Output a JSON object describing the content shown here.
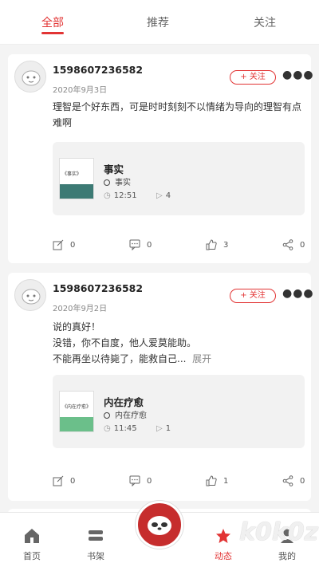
{
  "tabs": [
    {
      "label": "全部"
    },
    {
      "label": "推荐"
    },
    {
      "label": "关注"
    }
  ],
  "posts": [
    {
      "username": "1598607236582",
      "date": "2020年9月3日",
      "follow_label": "+ 关注",
      "text_lines": [
        "理智是个好东西，可是时时刻刻不以情绪为导向的理智有点",
        "难啊"
      ],
      "media": {
        "title": "事实",
        "subtitle": "事实",
        "duration": "12:51",
        "plays": "4",
        "thumb_title": "《事实》",
        "thumb_color": "#3c7a74"
      },
      "actions": {
        "share_count": "0",
        "comment_count": "0",
        "like_count": "3",
        "forward_count": "0"
      }
    },
    {
      "username": "1598607236582",
      "date": "2020年9月2日",
      "follow_label": "+ 关注",
      "text_lines": [
        "说的真好！",
        "没错，你不自度，他人爱莫能助。",
        "不能再坐以待毙了，能救自己..."
      ],
      "expand_label": "展开",
      "media": {
        "title": "内在疗愈",
        "subtitle": "内在疗愈",
        "duration": "11:45",
        "plays": "1",
        "thumb_title": "《内在疗愈》",
        "thumb_color": "#6bbf8a"
      },
      "actions": {
        "share_count": "0",
        "comment_count": "0",
        "like_count": "1",
        "forward_count": "0"
      }
    }
  ],
  "bottom_nav": [
    {
      "label": "首页",
      "icon": "home-icon"
    },
    {
      "label": "书架",
      "icon": "bookshelf-icon"
    },
    {
      "label": "动态",
      "icon": "feed-icon"
    },
    {
      "label": "我的",
      "icon": "profile-icon"
    }
  ],
  "colors": {
    "accent": "#e23434",
    "center": "#c62d2d"
  },
  "watermark": "k0k0z"
}
